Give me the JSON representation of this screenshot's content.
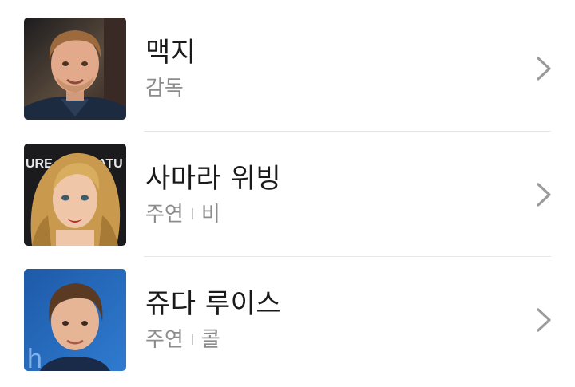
{
  "cast": [
    {
      "name": "맥지",
      "role": "감독",
      "character": "",
      "photo_icon": "person-photo-icon"
    },
    {
      "name": "사마라 위빙",
      "role": "주연",
      "character": "비",
      "photo_icon": "person-photo-icon"
    },
    {
      "name": "쥬다 루이스",
      "role": "주연",
      "character": "콜",
      "photo_icon": "person-photo-icon"
    }
  ],
  "colors": {
    "name_text": "#1a1a1a",
    "sub_text": "#8c8c8c",
    "chevron": "#9a9a9a",
    "divider": "#e6e6e6"
  }
}
